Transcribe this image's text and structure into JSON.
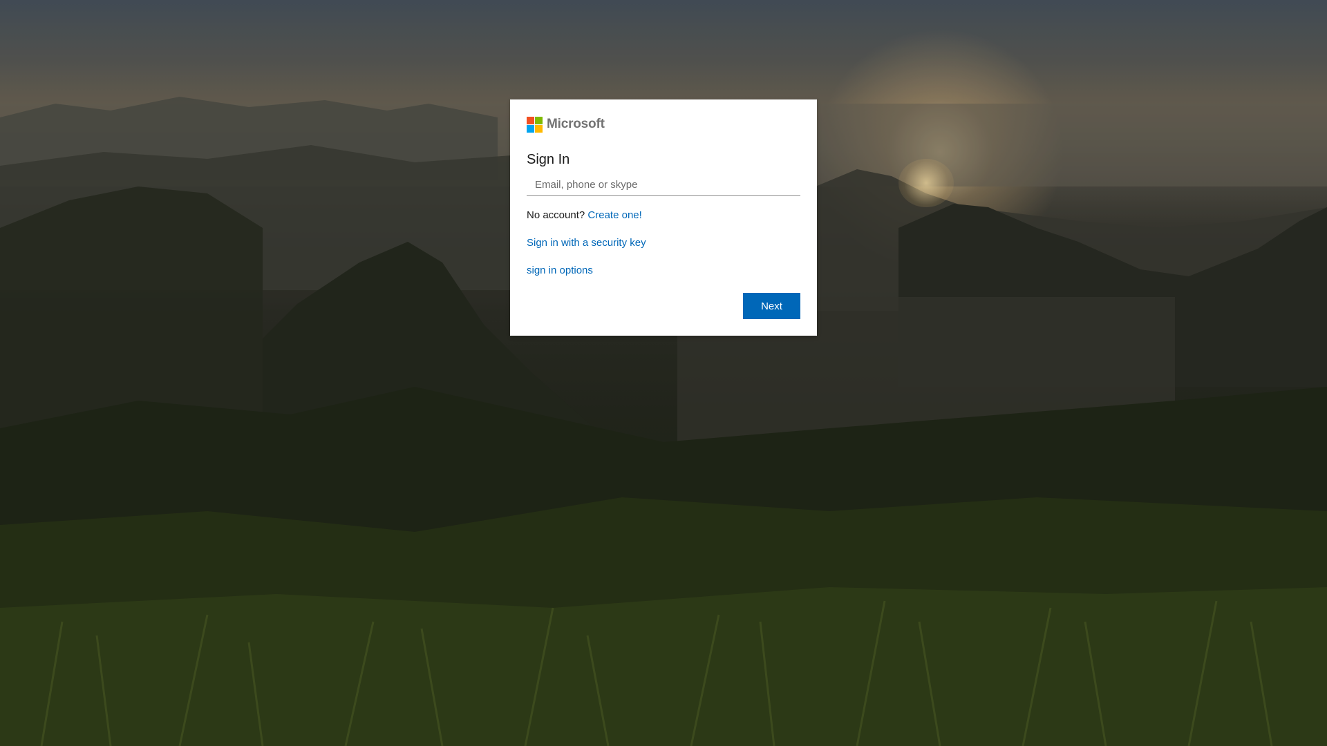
{
  "brand": {
    "name": "Microsoft",
    "logo_colors": [
      "#f25022",
      "#7fba00",
      "#00a4ef",
      "#ffb900"
    ]
  },
  "signin": {
    "title": "Sign In",
    "email_placeholder": "Email, phone or skype",
    "email_value": "",
    "no_account_text": "No account?",
    "create_link": "Create one!",
    "security_key_link": "Sign in with a security key",
    "options_link": "sign in options",
    "next_button": "Next"
  },
  "colors": {
    "accent": "#0067b8",
    "card_background": "#ffffff"
  }
}
